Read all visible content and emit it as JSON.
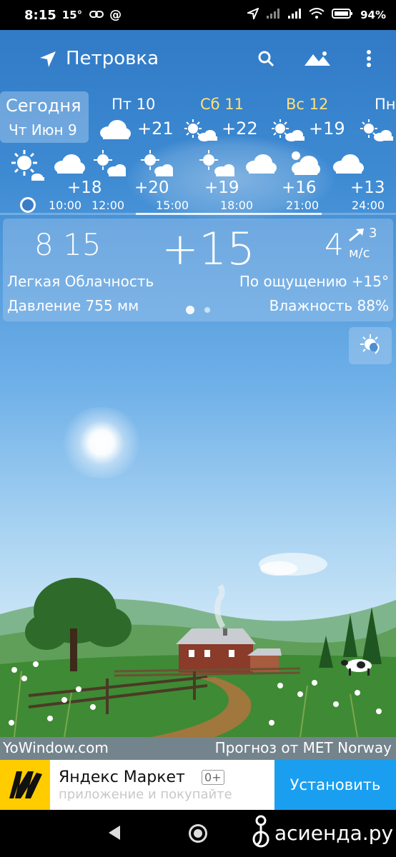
{
  "status_bar": {
    "time": "8:15",
    "temp": "15°",
    "battery": "94%"
  },
  "app_bar": {
    "location": "Петровка"
  },
  "days": {
    "today": {
      "label": "Сегодня",
      "date": "Чт Июн 9"
    },
    "list": [
      {
        "name": "Пт 10",
        "temp": "+21",
        "name_color": "#ffffff"
      },
      {
        "name": "Сб 11",
        "temp": "+22",
        "name_color": "#ffe07a"
      },
      {
        "name": "Вс 12",
        "temp": "+19",
        "name_color": "#ffe07a"
      },
      {
        "name": "Пн",
        "temp": "",
        "name_color": "#ffffff"
      }
    ]
  },
  "hourly": {
    "temps": [
      "+18",
      "+20",
      "+19",
      "+16",
      "+13"
    ],
    "times": [
      "10:00",
      "12:00",
      "15:00",
      "18:00",
      "21:00",
      "24:00"
    ]
  },
  "current": {
    "time": "8 15",
    "temp": "+15",
    "wind_speed": "4",
    "wind_dir": "3",
    "wind_unit": "м/с",
    "condition": "Легкая Облачность",
    "feels_like": "По ощущению +15°",
    "pressure": "Давление 755 мм",
    "humidity": "Влажность 88%"
  },
  "footer": {
    "brand": "YoWindow.com",
    "source": "Прогноз от MET Norway"
  },
  "ad": {
    "title": "Яндекс Маркет",
    "age": "0+",
    "subtitle": "приложение и покупайте",
    "button": "Установить"
  },
  "watermark": {
    "text": "асиенда.ру"
  },
  "colors": {
    "accent_weekend": "#ffe07a",
    "install_button": "#1a9ff0",
    "ad_logo": "#ffcc00"
  }
}
